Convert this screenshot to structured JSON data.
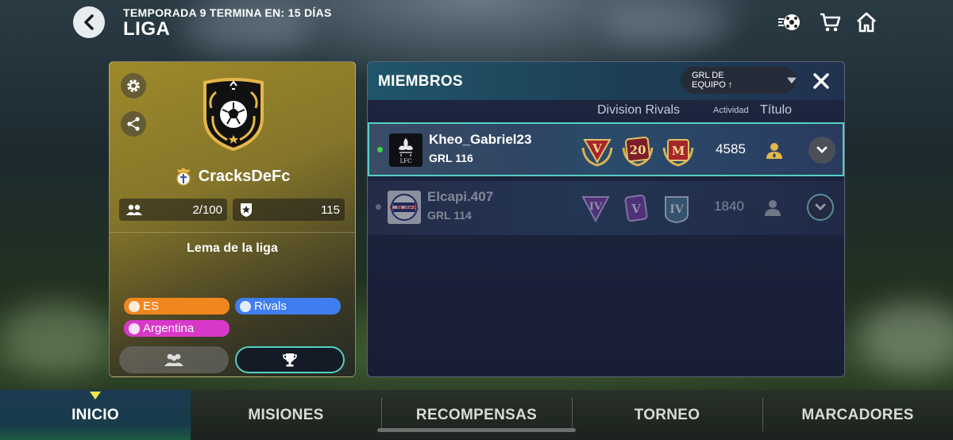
{
  "header": {
    "season_text": "TEMPORADA 9 TERMINA EN: 15 DÍAS",
    "title": "LIGA",
    "icons": [
      "back-chevron-icon",
      "ball-swap-icon",
      "cart-icon",
      "home-icon"
    ]
  },
  "league": {
    "club_name": "CracksDeFc",
    "members_count": "2/100",
    "points": "115",
    "motto": "Lema de la liga",
    "tags": {
      "language": "ES",
      "mode": "Rivals",
      "country": "Argentina"
    },
    "tag_colors": {
      "language": "#f0861e",
      "mode": "#3f7ef0",
      "country": "#d838c8"
    }
  },
  "members": {
    "title": "MIEMBROS",
    "sort_label": "GRL DE EQUIPO ↑",
    "columns": {
      "division_rivals": "Division Rivals",
      "activity": "Actividad",
      "title": "Título"
    },
    "rows": [
      {
        "name": "Kheo_Gabriel23",
        "grl": "GRL 116",
        "club_badge": "LFC",
        "badge_1": "V",
        "badge_2": "20",
        "badge_3": "M",
        "activity": "4585",
        "online": true
      },
      {
        "name": "Elcapi.407",
        "grl": "GRL 114",
        "club_badge": "C.N.deF.",
        "badge_1": "IV",
        "badge_2": "V",
        "badge_3": "IV",
        "activity": "1840",
        "online": false
      }
    ]
  },
  "nav": {
    "tabs": [
      "INICIO",
      "MISIONES",
      "RECOMPENSAS",
      "TORNEO",
      "MARCADORES"
    ],
    "active": "INICIO"
  },
  "colors": {
    "accent_teal": "#53d0c4",
    "online_green": "#3dd44a",
    "gold": "#e5b64a"
  }
}
